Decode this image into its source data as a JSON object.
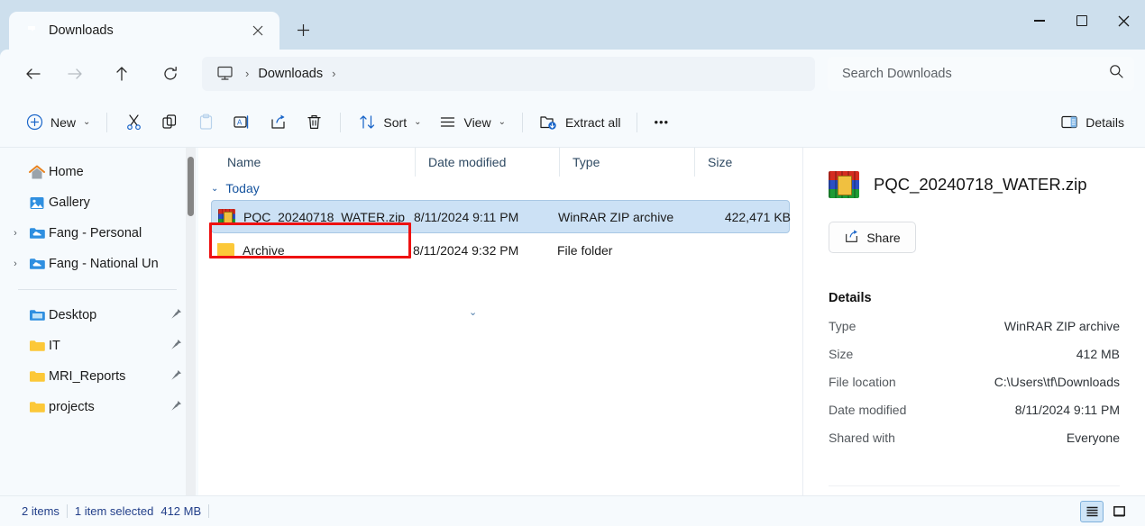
{
  "window": {
    "tab": {
      "title": "Downloads",
      "icon": "downloads-folder-icon",
      "close": "✕"
    },
    "new_tab": "+",
    "controls": {
      "minimize": "minimize",
      "maximize": "maximize",
      "close": "close"
    }
  },
  "navbar": {
    "back": "back-arrow",
    "forward": "forward-arrow",
    "up": "up-arrow",
    "refresh": "refresh-arrow",
    "breadcrumb": {
      "root_icon": "this-pc-icon",
      "sep1": "›",
      "current": "Downloads",
      "sep2": "›"
    },
    "search": {
      "placeholder": "Search Downloads",
      "value": "",
      "icon": "search-icon"
    }
  },
  "commandbar": {
    "new_label": "New",
    "cut_label": "Cut",
    "copy_label": "Copy",
    "paste_label": "Paste",
    "rename_label": "Rename",
    "share_label": "Share",
    "delete_label": "Delete",
    "sort_label": "Sort",
    "view_label": "View",
    "extract_label": "Extract all",
    "more_label": "•••",
    "details_label": "Details",
    "chevron": "⌄"
  },
  "sidebar": {
    "items": [
      {
        "label": "Home",
        "icon": "home-icon",
        "expand": "",
        "pin": false
      },
      {
        "label": "Gallery",
        "icon": "gallery-icon",
        "expand": "",
        "pin": false
      },
      {
        "label": "Fang - Personal",
        "icon": "onedrive-folder-icon",
        "expand": "›",
        "pin": false
      },
      {
        "label": "Fang - National Un",
        "icon": "onedrive-folder-icon",
        "expand": "›",
        "pin": false
      }
    ],
    "pinned": [
      {
        "label": "Desktop",
        "icon": "desktop-folder-icon",
        "pin": true
      },
      {
        "label": "IT",
        "icon": "folder-icon",
        "pin": true
      },
      {
        "label": "MRI_Reports",
        "icon": "folder-icon",
        "pin": true
      },
      {
        "label": "projects",
        "icon": "folder-icon",
        "pin": true
      }
    ]
  },
  "filelist": {
    "columns": {
      "name": "Name",
      "date": "Date modified",
      "type": "Type",
      "size": "Size"
    },
    "sort_indicator": "⌄",
    "group": {
      "label": "Today",
      "chevron": "⌄"
    },
    "rows": [
      {
        "name": "PQC_20240718_WATER.zip",
        "date": "8/11/2024 9:11 PM",
        "type": "WinRAR ZIP archive",
        "size": "422,471 KB",
        "icon": "winrar-archive-icon",
        "selected": true
      },
      {
        "name": "Archive",
        "date": "8/11/2024 9:32 PM",
        "type": "File folder",
        "size": "",
        "icon": "folder-icon",
        "selected": false
      }
    ]
  },
  "details": {
    "file_name": "PQC_20240718_WATER.zip",
    "file_icon": "winrar-archive-icon",
    "share_label": "Share",
    "heading": "Details",
    "fields": [
      {
        "key": "Type",
        "value": "WinRAR ZIP archive"
      },
      {
        "key": "Size",
        "value": "412 MB"
      },
      {
        "key": "File location",
        "value": "C:\\Users\\tf\\Downloads"
      },
      {
        "key": "Date modified",
        "value": "8/11/2024 9:11 PM"
      },
      {
        "key": "Shared with",
        "value": "Everyone"
      }
    ]
  },
  "statusbar": {
    "item_count": "2 items",
    "selection": "1 item selected",
    "selection_size": "412 MB",
    "view_details": "details-view-toggle",
    "view_icons": "large-icons-view-toggle"
  },
  "colors": {
    "titlebar": "#cddfed",
    "accent": "#15539e",
    "selected_row": "#cce1f5",
    "annotation": "#ee1111"
  }
}
